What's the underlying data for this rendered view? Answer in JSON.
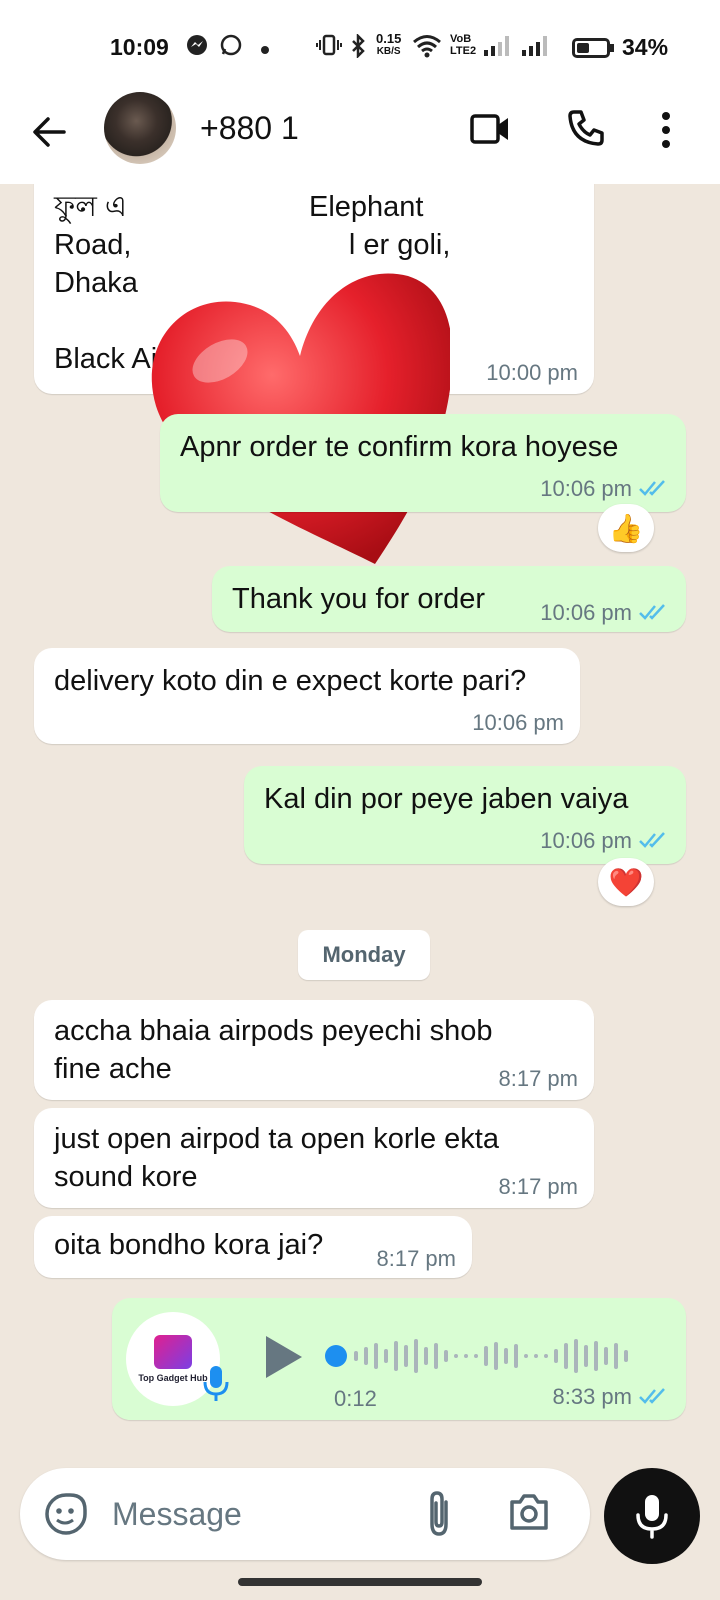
{
  "status_bar": {
    "time": "10:09",
    "data_rate": "0.15",
    "data_unit": "KB/S",
    "network_label_top": "VoB",
    "network_label_bottom": "LTE2",
    "battery": "34%"
  },
  "header": {
    "contact_name": "+880 1"
  },
  "messages": [
    {
      "dir": "in",
      "text": "ফুল এ             Elephant\nRoad,               l er goli,\nDhaka\n\nBlack Airpods",
      "time": "10:00 pm"
    },
    {
      "dir": "out",
      "text": "Apnr order te confirm kora hoyese",
      "time": "10:06 pm",
      "reaction": "👍"
    },
    {
      "dir": "out",
      "text": "Thank you for order",
      "time": "10:06 pm"
    },
    {
      "dir": "in",
      "text": "delivery koto din e expect korte pari?",
      "time": "10:06 pm"
    },
    {
      "dir": "out",
      "text": "Kal din por peye jaben vaiya",
      "time": "10:06 pm",
      "reaction": "❤️"
    },
    {
      "dir": "in",
      "text": "accha bhaia airpods peyechi shob\nfine ache",
      "time": "8:17 pm"
    },
    {
      "dir": "in",
      "text": "just open airpod ta open korle ekta\nsound kore",
      "time": "8:17 pm"
    },
    {
      "dir": "in",
      "text": "oita bondho kora jai?",
      "time": "8:17 pm"
    }
  ],
  "day_separator": "Monday",
  "voice_note": {
    "logo_text": "Top Gadget Hub",
    "duration": "0:12",
    "time": "8:33 pm"
  },
  "composer": {
    "placeholder": "Message"
  },
  "colors": {
    "chat_bg": "#efe7dd",
    "incoming": "#ffffff",
    "outgoing": "#d9fdd3",
    "read_ticks": "#53bdeb",
    "mic_button": "#111111"
  }
}
